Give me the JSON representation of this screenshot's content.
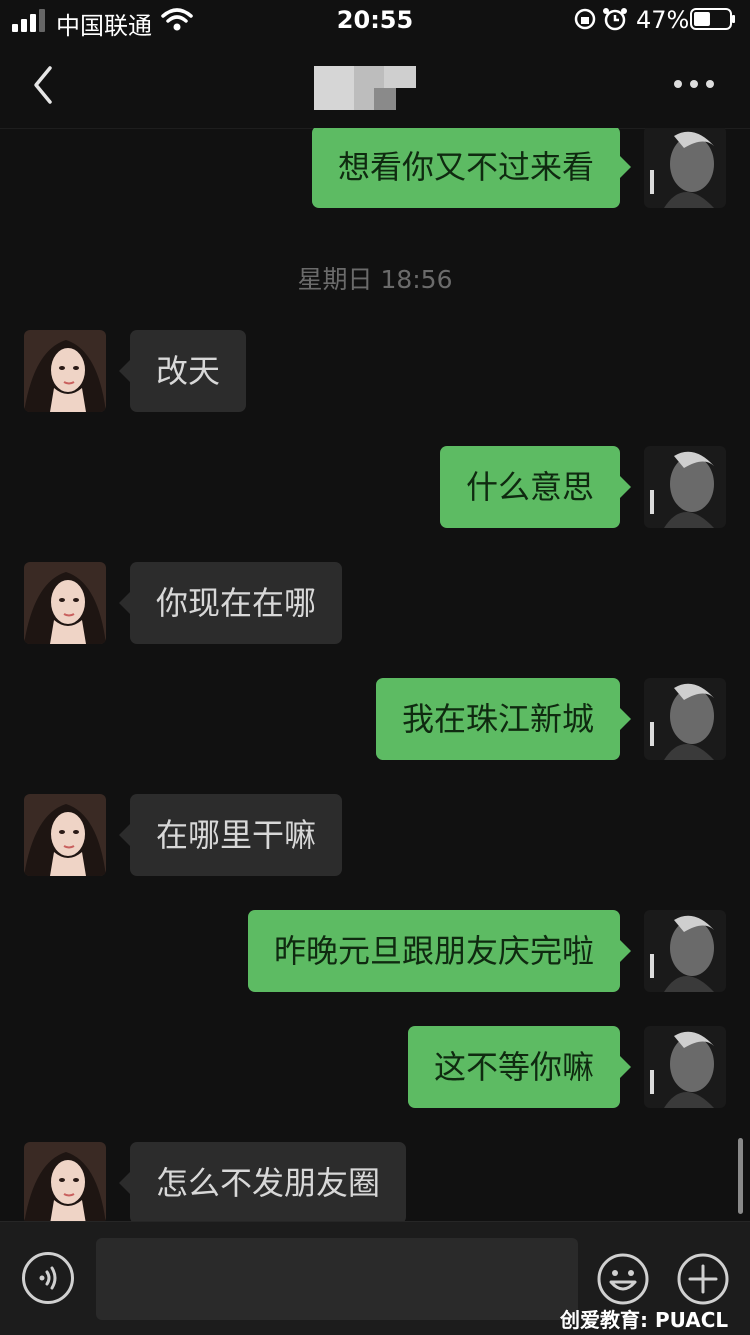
{
  "status_bar": {
    "carrier": "中国联通",
    "time": "20:55",
    "battery_percent": "47%",
    "signal_bars": 3,
    "battery_level": 0.47
  },
  "nav": {
    "back_icon": "chevron-left-icon",
    "more_icon": "ellipsis-icon"
  },
  "chat": {
    "timestamp": "星期日 18:56",
    "messages": [
      {
        "side": "right",
        "text": "想看你又不过来看"
      },
      {
        "side": "left",
        "text": "改天"
      },
      {
        "side": "right",
        "text": "什么意思"
      },
      {
        "side": "left",
        "text": "你现在在哪"
      },
      {
        "side": "right",
        "text": "我在珠江新城"
      },
      {
        "side": "left",
        "text": "在哪里干嘛"
      },
      {
        "side": "right",
        "text": "昨晚元旦跟朋友庆完啦"
      },
      {
        "side": "right",
        "text": "这不等你嘛"
      },
      {
        "side": "left",
        "text": "怎么不发朋友圈"
      }
    ]
  },
  "input_bar": {
    "voice_icon": "voice-icon",
    "emoji_icon": "emoji-icon",
    "plus_icon": "plus-icon",
    "text_value": ""
  },
  "watermark": "创爱教育: PUACL",
  "colors": {
    "background": "#111111",
    "bubble_sent": "#5dbb63",
    "bubble_received": "#2c2c2c"
  }
}
